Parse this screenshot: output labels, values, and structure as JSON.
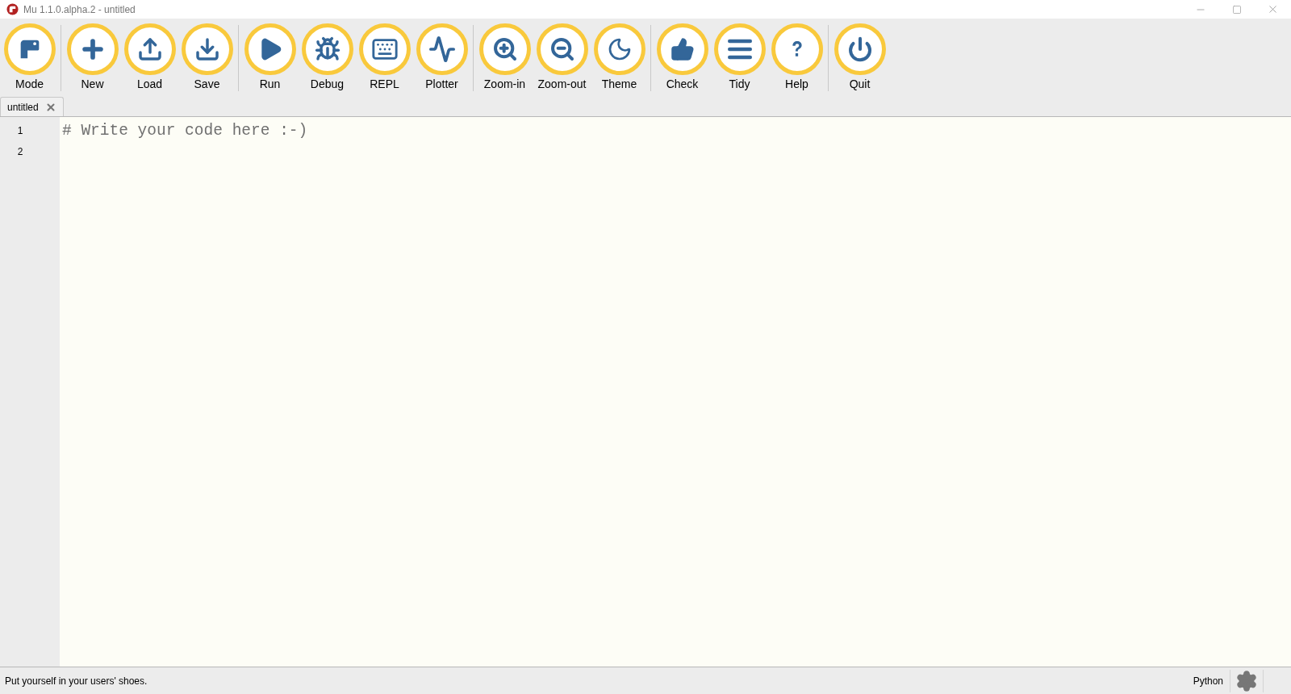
{
  "window": {
    "title": "Mu 1.1.0.alpha.2 - untitled"
  },
  "toolbar": {
    "groups": [
      [
        {
          "label": "Mode",
          "kind": "mode"
        }
      ],
      [
        {
          "label": "New",
          "kind": "new"
        },
        {
          "label": "Load",
          "kind": "load"
        },
        {
          "label": "Save",
          "kind": "save"
        }
      ],
      [
        {
          "label": "Run",
          "kind": "run"
        },
        {
          "label": "Debug",
          "kind": "debug"
        },
        {
          "label": "REPL",
          "kind": "repl"
        },
        {
          "label": "Plotter",
          "kind": "plotter"
        }
      ],
      [
        {
          "label": "Zoom-in",
          "kind": "zoomin"
        },
        {
          "label": "Zoom-out",
          "kind": "zoomout"
        },
        {
          "label": "Theme",
          "kind": "theme"
        }
      ],
      [
        {
          "label": "Check",
          "kind": "check"
        },
        {
          "label": "Tidy",
          "kind": "tidy"
        },
        {
          "label": "Help",
          "kind": "help"
        }
      ],
      [
        {
          "label": "Quit",
          "kind": "quit"
        }
      ]
    ]
  },
  "tabs": [
    {
      "label": "untitled",
      "selected": true
    }
  ],
  "editor": {
    "line_numbers": [
      "1",
      "2"
    ],
    "lines": [
      "# Write your code here :-)"
    ]
  },
  "status_bar": {
    "message": "Put yourself in your users' shoes.",
    "mode": "Python"
  }
}
